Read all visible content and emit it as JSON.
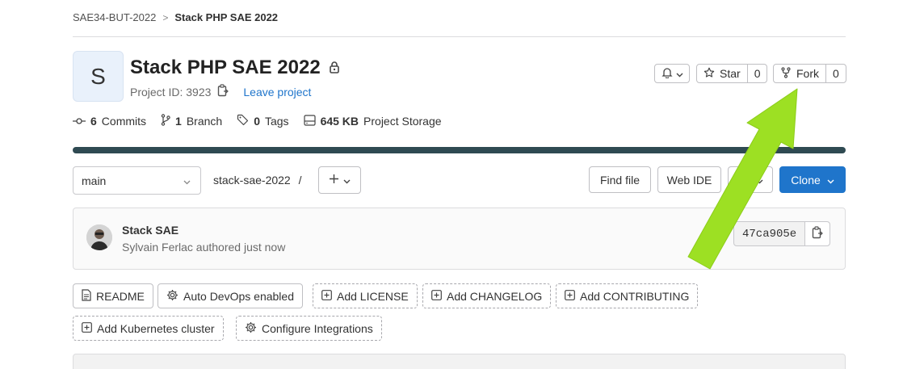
{
  "breadcrumb": {
    "group": "SAE34-BUT-2022",
    "separator": ">",
    "project": "Stack PHP SAE 2022"
  },
  "project": {
    "avatar_letter": "S",
    "title": "Stack PHP SAE 2022",
    "id_label": "Project ID: 3923",
    "leave_label": "Leave project"
  },
  "header_actions": {
    "star_label": "Star",
    "star_count": "0",
    "fork_label": "Fork",
    "fork_count": "0"
  },
  "stats": {
    "commits_count": "6",
    "commits_label": "Commits",
    "branch_count": "1",
    "branch_label": "Branch",
    "tags_count": "0",
    "tags_label": "Tags",
    "storage_size": "645 KB",
    "storage_label": "Project Storage"
  },
  "repo_toolbar": {
    "branch": "main",
    "path": "stack-sae-2022",
    "path_sep": "/",
    "find_file": "Find file",
    "web_ide": "Web IDE",
    "clone": "Clone"
  },
  "last_commit": {
    "title": "Stack SAE",
    "subtitle": "Sylvain Ferlac authored just now",
    "sha": "47ca905e"
  },
  "quick_actions": [
    {
      "label": "README",
      "style": "solid",
      "icon": "file-icon"
    },
    {
      "label": "Auto DevOps enabled",
      "style": "solid",
      "icon": "gear-icon"
    },
    {
      "label": "Add LICENSE",
      "style": "dashed",
      "icon": "plus-square-icon"
    },
    {
      "label": "Add CHANGELOG",
      "style": "dashed",
      "icon": "plus-square-icon"
    },
    {
      "label": "Add CONTRIBUTING",
      "style": "dashed",
      "icon": "plus-square-icon"
    },
    {
      "label": "Add Kubernetes cluster",
      "style": "dashed",
      "icon": "plus-square-icon"
    },
    {
      "label": "Configure Integrations",
      "style": "dashed",
      "icon": "gear-icon"
    }
  ],
  "colors": {
    "accent": "#1f75cb",
    "arrow": "#9de023",
    "bar": "#2f4a52"
  }
}
